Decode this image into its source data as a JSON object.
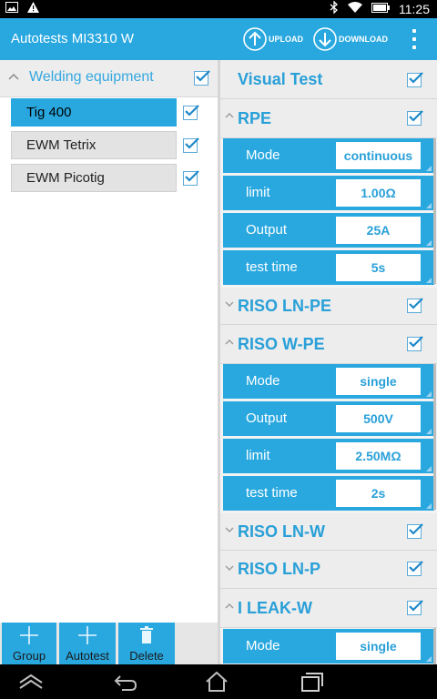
{
  "status_bar": {
    "time": "11:25",
    "left_icons": [
      "image-icon",
      "warning-icon"
    ],
    "right_icons": [
      "bluetooth-icon",
      "wifi-icon",
      "battery-icon"
    ]
  },
  "action_bar": {
    "title": "Autotests MI3310 W",
    "upload_label": "UPLOAD",
    "download_label": "DOWNLOAD",
    "menu_icon": "overflow-menu-icon"
  },
  "left": {
    "group": {
      "label": "Welding equipment",
      "checked": true,
      "expanded": true
    },
    "devices": [
      {
        "label": "Tig 400",
        "checked": true,
        "selected": true
      },
      {
        "label": "EWM Tetrix",
        "checked": true,
        "selected": false
      },
      {
        "label": "EWM Picotig",
        "checked": true,
        "selected": false
      }
    ]
  },
  "toolbar": {
    "group_label": "Group",
    "autotest_label": "Autotest",
    "delete_label": "Delete"
  },
  "tests": [
    {
      "name": "Visual Test",
      "checked": true,
      "expanded": false,
      "params": []
    },
    {
      "name": "RPE",
      "checked": true,
      "expanded": true,
      "params": [
        {
          "label": "Mode",
          "value": "continuous"
        },
        {
          "label": "limit",
          "value": "1.00Ω"
        },
        {
          "label": "Output",
          "value": "25A"
        },
        {
          "label": "test time",
          "value": "5s"
        }
      ]
    },
    {
      "name": "RISO LN-PE",
      "checked": true,
      "expanded": false,
      "params": []
    },
    {
      "name": "RISO W-PE",
      "checked": true,
      "expanded": true,
      "params": [
        {
          "label": "Mode",
          "value": "single"
        },
        {
          "label": "Output",
          "value": "500V"
        },
        {
          "label": "limit",
          "value": "2.50MΩ"
        },
        {
          "label": "test time",
          "value": "2s"
        }
      ]
    },
    {
      "name": "RISO LN-W",
      "checked": true,
      "expanded": false,
      "params": []
    },
    {
      "name": "RISO LN-P",
      "checked": true,
      "expanded": false,
      "params": []
    },
    {
      "name": "I LEAK-W",
      "checked": true,
      "expanded": true,
      "params": [
        {
          "label": "Mode",
          "value": "single"
        }
      ]
    }
  ],
  "colors": {
    "accent": "#29a8e0",
    "heading": "#29a0d8",
    "row_bg": "#ededed"
  }
}
